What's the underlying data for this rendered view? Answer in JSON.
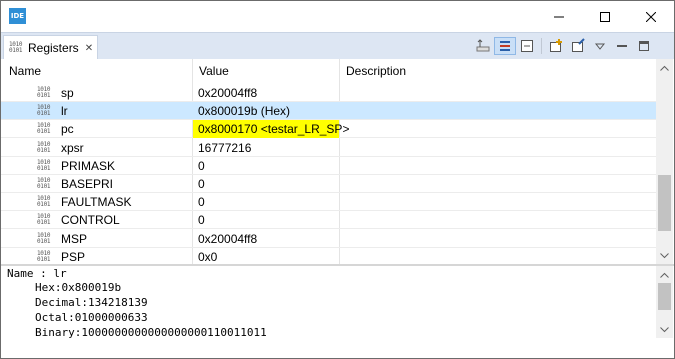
{
  "window": {
    "app_icon_text": "IDE",
    "controls": [
      "minimize-icon",
      "maximize-icon",
      "close-icon"
    ]
  },
  "tab": {
    "label": "Registers",
    "icon_text": "1010\n0101",
    "close_glyph": "✕"
  },
  "toolbar": {
    "buttons": [
      "select-icon",
      "show-type-icon",
      "collapse-all-icon",
      "add-group-icon",
      "edit-group-icon",
      "view-menu-icon",
      "minimize-view-icon",
      "maximize-view-icon"
    ]
  },
  "table": {
    "columns": [
      "Name",
      "Value",
      "Description"
    ],
    "rows": [
      {
        "name": "sp",
        "value": "0x20004ff8",
        "description": "",
        "selected": false,
        "highlight": false
      },
      {
        "name": "lr",
        "value": "0x800019b (Hex)",
        "description": "",
        "selected": true,
        "highlight": false
      },
      {
        "name": "pc",
        "value": "0x8000170 <testar_LR_SP>",
        "description": "",
        "selected": false,
        "highlight": true
      },
      {
        "name": "xpsr",
        "value": "16777216",
        "description": "",
        "selected": false,
        "highlight": false
      },
      {
        "name": "PRIMASK",
        "value": "0",
        "description": "",
        "selected": false,
        "highlight": false
      },
      {
        "name": "BASEPRI",
        "value": "0",
        "description": "",
        "selected": false,
        "highlight": false
      },
      {
        "name": "FAULTMASK",
        "value": "0",
        "description": "",
        "selected": false,
        "highlight": false
      },
      {
        "name": "CONTROL",
        "value": "0",
        "description": "",
        "selected": false,
        "highlight": false
      },
      {
        "name": "MSP",
        "value": "0x20004ff8",
        "description": "",
        "selected": false,
        "highlight": false
      },
      {
        "name": "PSP",
        "value": "0x0",
        "description": "",
        "selected": false,
        "highlight": false
      }
    ]
  },
  "details": {
    "name_line": "Name : lr",
    "lines": [
      "Hex:0x800019b",
      "Decimal:134218139",
      "Octal:01000000633",
      "Binary:1000000000000000000110011011"
    ]
  },
  "colors": {
    "selection": "#cce8ff",
    "highlight": "#ffff00",
    "tabstrip": "#dde6f3"
  }
}
